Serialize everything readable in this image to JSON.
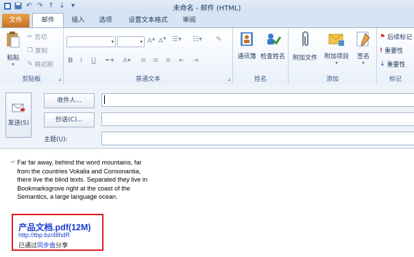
{
  "window": {
    "title": "未命名 - 邮件 (HTML)"
  },
  "tabs": [
    {
      "label": "文件"
    },
    {
      "label": "邮件"
    },
    {
      "label": "插入"
    },
    {
      "label": "选项"
    },
    {
      "label": "设置文本格式"
    },
    {
      "label": "审阅"
    }
  ],
  "ribbon": {
    "clipboard": {
      "label": "剪贴板",
      "paste": "粘贴",
      "cut": "剪切",
      "copy": "复制",
      "format_painter": "格式刷"
    },
    "basic_text": {
      "label": "普通文本"
    },
    "names": {
      "label": "姓名",
      "address_book": "通讯簿",
      "check_names": "检查姓名"
    },
    "include": {
      "label": "添加",
      "attach_file": "附加文件",
      "attach_item": "附加项目",
      "signature": "签名"
    },
    "tags": {
      "label": "标记",
      "follow_up": "后续标记",
      "high_importance": "重要性",
      "low_importance": "重要性"
    }
  },
  "compose": {
    "send": "发送(S)",
    "to": "收件人...",
    "cc": "抄送(C)...",
    "subject": "主题(U):"
  },
  "body": {
    "lines": [
      "Far far away, behind the word mountains, far",
      "from the countries Vokalia and Consonantia,",
      "there live the blind texts. Separated they live in",
      "Bookmarksgrove right at the coast of the",
      "Semantics, a large language ocean."
    ],
    "attachment": {
      "title": "产品文档.pdf(12M)",
      "link": "http://tbp.bz/4llhdR",
      "share_prefix": "已通过",
      "share_link": "同步盘",
      "share_suffix": "分享"
    }
  }
}
